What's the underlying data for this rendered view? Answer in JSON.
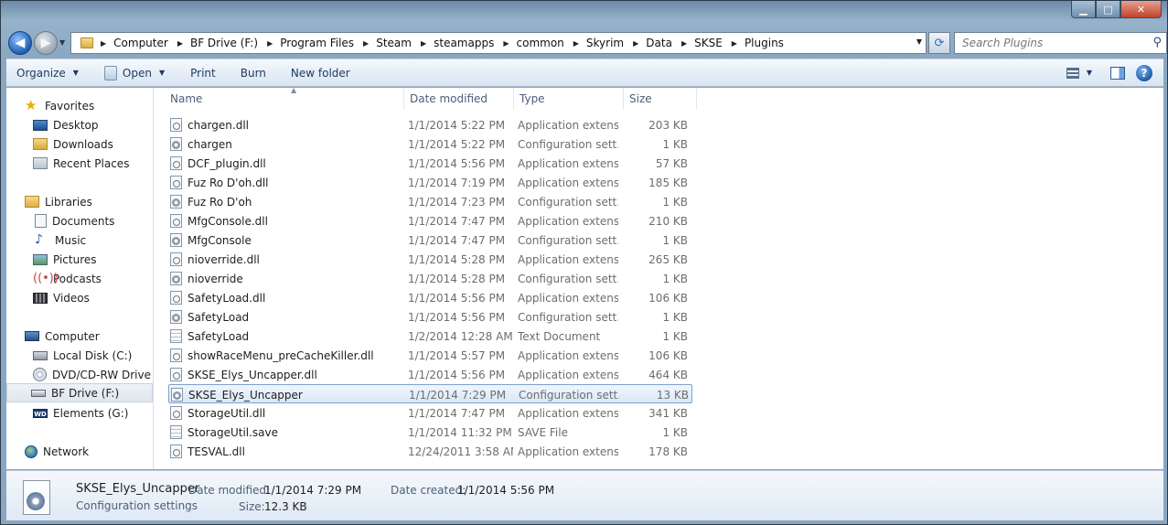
{
  "window": {
    "minimize_glyph": "▁",
    "maximize_glyph": "□",
    "close_glyph": "✕"
  },
  "address_bar": {
    "crumbs": [
      "Computer",
      "BF Drive (F:)",
      "Program Files",
      "Steam",
      "steamapps",
      "common",
      "Skyrim",
      "Data",
      "SKSE",
      "Plugins"
    ]
  },
  "search": {
    "placeholder": "Search Plugins"
  },
  "toolbar": {
    "organize": "Organize",
    "open": "Open",
    "print": "Print",
    "burn": "Burn",
    "new_folder": "New folder"
  },
  "nav_pane": {
    "favorites": "Favorites",
    "desktop": "Desktop",
    "downloads": "Downloads",
    "recent_places": "Recent Places",
    "libraries": "Libraries",
    "documents": "Documents",
    "music": "Music",
    "pictures": "Pictures",
    "podcasts": "Podcasts",
    "videos": "Videos",
    "computer": "Computer",
    "local_disk": "Local Disk (C:)",
    "dvd_drive": "DVD/CD-RW Drive (D",
    "bf_drive": "BF Drive (F:)",
    "elements": "Elements (G:)",
    "network": "Network"
  },
  "columns": {
    "name": "Name",
    "date_modified": "Date modified",
    "type": "Type",
    "size": "Size"
  },
  "files": [
    {
      "name": "chargen.dll",
      "date": "1/1/2014 5:22 PM",
      "type": "Application extens...",
      "size": "203 KB",
      "icon": "dll-file-icon"
    },
    {
      "name": "chargen",
      "date": "1/1/2014 5:22 PM",
      "type": "Configuration sett...",
      "size": "1 KB",
      "icon": "config-file-icon"
    },
    {
      "name": "DCF_plugin.dll",
      "date": "1/1/2014 5:56 PM",
      "type": "Application extens...",
      "size": "57 KB",
      "icon": "dll-file-icon"
    },
    {
      "name": "Fuz Ro D'oh.dll",
      "date": "1/1/2014 7:19 PM",
      "type": "Application extens...",
      "size": "185 KB",
      "icon": "dll-file-icon"
    },
    {
      "name": "Fuz Ro D'oh",
      "date": "1/1/2014 7:23 PM",
      "type": "Configuration sett...",
      "size": "1 KB",
      "icon": "config-file-icon"
    },
    {
      "name": "MfgConsole.dll",
      "date": "1/1/2014 7:47 PM",
      "type": "Application extens...",
      "size": "210 KB",
      "icon": "dll-file-icon"
    },
    {
      "name": "MfgConsole",
      "date": "1/1/2014 7:47 PM",
      "type": "Configuration sett...",
      "size": "1 KB",
      "icon": "config-file-icon"
    },
    {
      "name": "nioverride.dll",
      "date": "1/1/2014 5:28 PM",
      "type": "Application extens...",
      "size": "265 KB",
      "icon": "dll-file-icon"
    },
    {
      "name": "nioverride",
      "date": "1/1/2014 5:28 PM",
      "type": "Configuration sett...",
      "size": "1 KB",
      "icon": "config-file-icon"
    },
    {
      "name": "SafetyLoad.dll",
      "date": "1/1/2014 5:56 PM",
      "type": "Application extens...",
      "size": "106 KB",
      "icon": "dll-file-icon"
    },
    {
      "name": "SafetyLoad",
      "date": "1/1/2014 5:56 PM",
      "type": "Configuration sett...",
      "size": "1 KB",
      "icon": "config-file-icon"
    },
    {
      "name": "SafetyLoad",
      "date": "1/2/2014 12:28 AM",
      "type": "Text Document",
      "size": "1 KB",
      "icon": "text-file-icon"
    },
    {
      "name": "showRaceMenu_preCacheKiller.dll",
      "date": "1/1/2014 5:57 PM",
      "type": "Application extens...",
      "size": "106 KB",
      "icon": "dll-file-icon"
    },
    {
      "name": "SKSE_Elys_Uncapper.dll",
      "date": "1/1/2014 5:56 PM",
      "type": "Application extens...",
      "size": "464 KB",
      "icon": "dll-file-icon"
    },
    {
      "name": "SKSE_Elys_Uncapper",
      "date": "1/1/2014 7:29 PM",
      "type": "Configuration sett...",
      "size": "13 KB",
      "icon": "config-file-icon",
      "selected": true
    },
    {
      "name": "StorageUtil.dll",
      "date": "1/1/2014 7:47 PM",
      "type": "Application extens...",
      "size": "341 KB",
      "icon": "dll-file-icon"
    },
    {
      "name": "StorageUtil.save",
      "date": "1/1/2014 11:32 PM",
      "type": "SAVE File",
      "size": "1 KB",
      "icon": "text-file-icon"
    },
    {
      "name": "TESVAL.dll",
      "date": "12/24/2011 3:58 AM",
      "type": "Application extens...",
      "size": "178 KB",
      "icon": "dll-file-icon"
    }
  ],
  "details": {
    "name": "SKSE_Elys_Uncapper",
    "type": "Configuration settings",
    "date_modified_label": "Date modified:",
    "date_modified": "1/1/2014 7:29 PM",
    "size_label": "Size:",
    "size": "12.3 KB",
    "date_created_label": "Date created:",
    "date_created": "1/1/2014 5:56 PM"
  }
}
